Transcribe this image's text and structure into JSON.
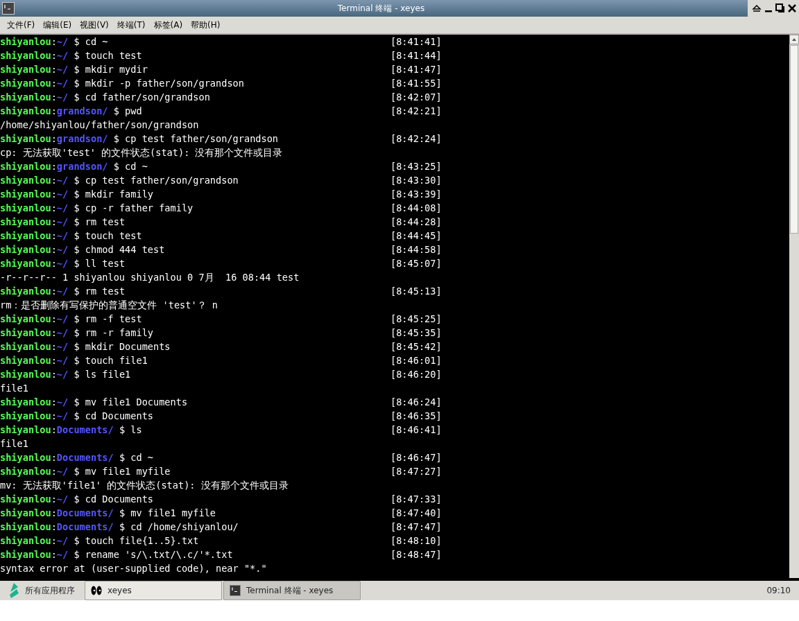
{
  "window": {
    "title": "Terminal 终端 - xeyes"
  },
  "menu": [
    {
      "label": "文件(F)"
    },
    {
      "label": "编辑(E)"
    },
    {
      "label": "视图(V)"
    },
    {
      "label": "终端(T)"
    },
    {
      "label": "标签(A)"
    },
    {
      "label": "帮助(H)"
    }
  ],
  "terminal": {
    "lines": [
      {
        "kind": "prompt",
        "user": "shiyanlou",
        "sep": ":",
        "dir": "~/",
        "command": "$ cd ~",
        "time": "[8:41:41]"
      },
      {
        "kind": "prompt",
        "user": "shiyanlou",
        "sep": ":",
        "dir": "~/",
        "command": "$ touch test",
        "time": "[8:41:44]"
      },
      {
        "kind": "prompt",
        "user": "shiyanlou",
        "sep": ":",
        "dir": "~/",
        "command": "$ mkdir mydir",
        "time": "[8:41:47]"
      },
      {
        "kind": "prompt",
        "user": "shiyanlou",
        "sep": ":",
        "dir": "~/",
        "command": "$ mkdir -p father/son/grandson",
        "time": "[8:41:55]"
      },
      {
        "kind": "prompt",
        "user": "shiyanlou",
        "sep": ":",
        "dir": "~/",
        "command": "$ cd father/son/grandson",
        "time": "[8:42:07]"
      },
      {
        "kind": "prompt",
        "user": "shiyanlou",
        "sep": ":",
        "dir": "grandson/",
        "command": "$ pwd",
        "time": "[8:42:21]"
      },
      {
        "kind": "output",
        "text": "/home/shiyanlou/father/son/grandson"
      },
      {
        "kind": "prompt",
        "user": "shiyanlou",
        "sep": ":",
        "dir": "grandson/",
        "command": "$ cp test father/son/grandson",
        "time": "[8:42:24]"
      },
      {
        "kind": "output",
        "text": "cp: 无法获取'test' 的文件状态(stat): 没有那个文件或目录"
      },
      {
        "kind": "prompt",
        "user": "shiyanlou",
        "sep": ":",
        "dir": "grandson/",
        "command": "$ cd ~",
        "time": "[8:43:25]"
      },
      {
        "kind": "prompt",
        "user": "shiyanlou",
        "sep": ":",
        "dir": "~/",
        "command": "$ cp test father/son/grandson",
        "time": "[8:43:30]"
      },
      {
        "kind": "prompt",
        "user": "shiyanlou",
        "sep": ":",
        "dir": "~/",
        "command": "$ mkdir family",
        "time": "[8:43:39]"
      },
      {
        "kind": "prompt",
        "user": "shiyanlou",
        "sep": ":",
        "dir": "~/",
        "command": "$ cp -r father family",
        "time": "[8:44:08]"
      },
      {
        "kind": "prompt",
        "user": "shiyanlou",
        "sep": ":",
        "dir": "~/",
        "command": "$ rm test",
        "time": "[8:44:28]"
      },
      {
        "kind": "prompt",
        "user": "shiyanlou",
        "sep": ":",
        "dir": "~/",
        "command": "$ touch test",
        "time": "[8:44:45]"
      },
      {
        "kind": "prompt",
        "user": "shiyanlou",
        "sep": ":",
        "dir": "~/",
        "command": "$ chmod 444 test",
        "time": "[8:44:58]"
      },
      {
        "kind": "prompt",
        "user": "shiyanlou",
        "sep": ":",
        "dir": "~/",
        "command": "$ ll test",
        "time": "[8:45:07]"
      },
      {
        "kind": "output",
        "text": "-r--r--r-- 1 shiyanlou shiyanlou 0 7月  16 08:44 test"
      },
      {
        "kind": "prompt",
        "user": "shiyanlou",
        "sep": ":",
        "dir": "~/",
        "command": "$ rm test",
        "time": "[8:45:13]"
      },
      {
        "kind": "output",
        "text": "rm：是否删除有写保护的普通空文件 'test'？ n"
      },
      {
        "kind": "prompt",
        "user": "shiyanlou",
        "sep": ":",
        "dir": "~/",
        "command": "$ rm -f test",
        "time": "[8:45:25]"
      },
      {
        "kind": "prompt",
        "user": "shiyanlou",
        "sep": ":",
        "dir": "~/",
        "command": "$ rm -r family",
        "time": "[8:45:35]"
      },
      {
        "kind": "prompt",
        "user": "shiyanlou",
        "sep": ":",
        "dir": "~/",
        "command": "$ mkdir Documents",
        "time": "[8:45:42]"
      },
      {
        "kind": "prompt",
        "user": "shiyanlou",
        "sep": ":",
        "dir": "~/",
        "command": "$ touch file1",
        "time": "[8:46:01]"
      },
      {
        "kind": "prompt",
        "user": "shiyanlou",
        "sep": ":",
        "dir": "~/",
        "command": "$ ls file1",
        "time": "[8:46:20]"
      },
      {
        "kind": "output",
        "text": "file1"
      },
      {
        "kind": "prompt",
        "user": "shiyanlou",
        "sep": ":",
        "dir": "~/",
        "command": "$ mv file1 Documents",
        "time": "[8:46:24]"
      },
      {
        "kind": "prompt",
        "user": "shiyanlou",
        "sep": ":",
        "dir": "~/",
        "command": "$ cd Documents",
        "time": "[8:46:35]"
      },
      {
        "kind": "prompt",
        "user": "shiyanlou",
        "sep": ":",
        "dir": "Documents/",
        "command": "$ ls",
        "time": "[8:46:41]"
      },
      {
        "kind": "output",
        "text": "file1"
      },
      {
        "kind": "prompt",
        "user": "shiyanlou",
        "sep": ":",
        "dir": "Documents/",
        "command": "$ cd ~",
        "time": "[8:46:47]"
      },
      {
        "kind": "prompt",
        "user": "shiyanlou",
        "sep": ":",
        "dir": "~/",
        "command": "$ mv file1 myfile",
        "time": "[8:47:27]"
      },
      {
        "kind": "output",
        "text": "mv: 无法获取'file1' 的文件状态(stat): 没有那个文件或目录"
      },
      {
        "kind": "prompt",
        "user": "shiyanlou",
        "sep": ":",
        "dir": "~/",
        "command": "$ cd Documents",
        "time": "[8:47:33]"
      },
      {
        "kind": "prompt",
        "user": "shiyanlou",
        "sep": ":",
        "dir": "Documents/",
        "command": "$ mv file1 myfile",
        "time": "[8:47:40]"
      },
      {
        "kind": "prompt",
        "user": "shiyanlou",
        "sep": ":",
        "dir": "Documents/",
        "command": "$ cd /home/shiyanlou/",
        "time": "[8:47:47]"
      },
      {
        "kind": "prompt",
        "user": "shiyanlou",
        "sep": ":",
        "dir": "~/",
        "command": "$ touch file{1..5}.txt",
        "time": "[8:48:10]"
      },
      {
        "kind": "prompt",
        "user": "shiyanlou",
        "sep": ":",
        "dir": "~/",
        "command": "$ rename 's/\\.txt/\\.c/'*.txt",
        "time": "[8:48:47]"
      },
      {
        "kind": "output",
        "text": "syntax error at (user-supplied code), near \"*.\""
      }
    ]
  },
  "taskbar": {
    "start": "所有应用程序",
    "tasks": [
      {
        "label": "xeyes",
        "kind": "eyes",
        "selected": false
      },
      {
        "label": "Terminal 终端 - xeyes",
        "kind": "terminal",
        "selected": true
      }
    ],
    "clock": "09:10"
  }
}
